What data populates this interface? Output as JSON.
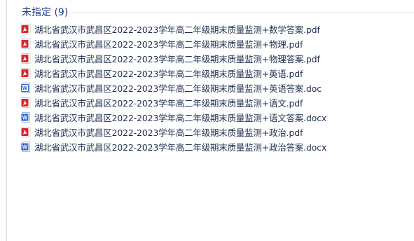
{
  "group": {
    "title": "未指定 (9)"
  },
  "files": [
    {
      "name": "湖北省武汉市武昌区2022-2023学年高二年级期末质量监测+数学答案.pdf",
      "icon": "pdf-icon"
    },
    {
      "name": "湖北省武汉市武昌区2022-2023学年高二年级期末质量监测+物理.pdf",
      "icon": "pdf-icon"
    },
    {
      "name": "湖北省武汉市武昌区2022-2023学年高二年级期末质量监测+物理答案.pdf",
      "icon": "pdf-icon"
    },
    {
      "name": "湖北省武汉市武昌区2022-2023学年高二年级期末质量监测+英语.pdf",
      "icon": "pdf-icon"
    },
    {
      "name": "湖北省武汉市武昌区2022-2023学年高二年级期末质量监测+英语答案.doc",
      "icon": "doc-icon"
    },
    {
      "name": "湖北省武汉市武昌区2022-2023学年高二年级期末质量监测+语文.pdf",
      "icon": "pdf-icon"
    },
    {
      "name": "湖北省武汉市武昌区2022-2023学年高二年级期末质量监测+语文答案.docx",
      "icon": "docx-icon"
    },
    {
      "name": "湖北省武汉市武昌区2022-2023学年高二年级期末质量监测+政治.pdf",
      "icon": "pdf-icon"
    },
    {
      "name": "湖北省武汉市武昌区2022-2023学年高二年级期末质量监测+政治答案.docx",
      "icon": "docx-icon"
    }
  ],
  "colors": {
    "group_title": "#1e3f8c",
    "file_text": "#1f2d4d",
    "pdf_red": "#d7282b",
    "word_blue": "#2b63c7"
  }
}
